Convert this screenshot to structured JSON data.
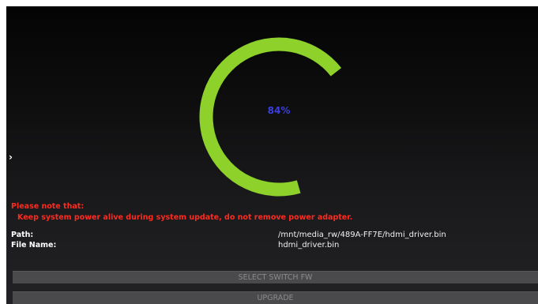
{
  "progress": {
    "label": "84%",
    "value": 84,
    "color": "#8ed12a",
    "label_color": "#3b3fe0"
  },
  "nav": {
    "arrow": "›",
    "arrow_icon": "chevron-right-icon"
  },
  "notice": {
    "title": "Please note that:",
    "body": "Keep system power alive during system update, do not remove power adapter.",
    "color": "#ff2a1e"
  },
  "info": {
    "path_label": "Path:",
    "path_value": "/mnt/media_rw/489A-FF7E/hdmi_driver.bin",
    "file_label": "File Name:",
    "file_value": "hdmi_driver.bin"
  },
  "buttons": {
    "select_switch_fw": "SELECT SWITCH FW",
    "upgrade": "UPGRADE"
  }
}
